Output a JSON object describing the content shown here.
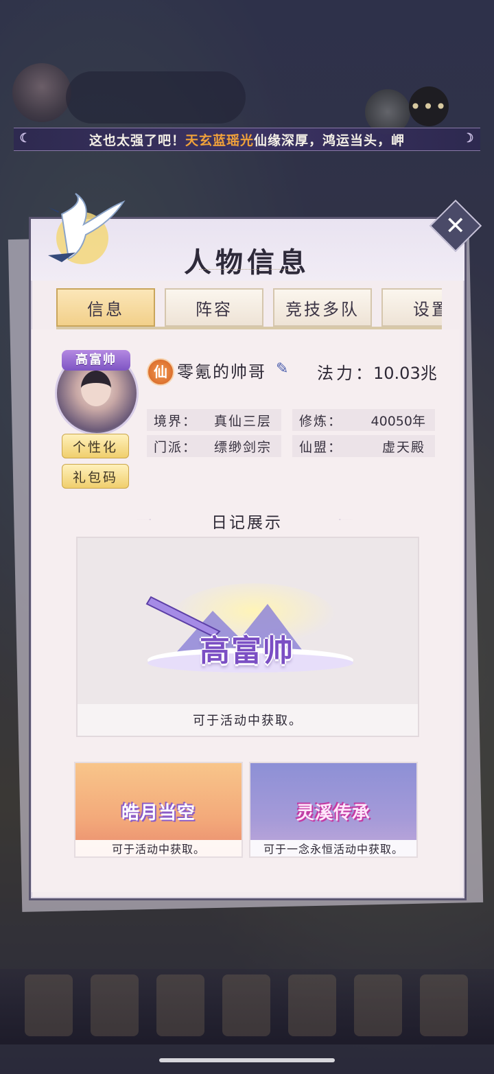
{
  "marquee": {
    "prefix": "这也太强了吧！",
    "highlight": "天玄蓝瑶光",
    "suffix": "仙缘深厚，鸿运当头，岬"
  },
  "chat_button": {
    "icon": "chat-bubble-icon",
    "glyph": "•••"
  },
  "panel": {
    "title": "人物信息",
    "close_glyph": "✕"
  },
  "tabs": [
    {
      "label": "信息",
      "active": true
    },
    {
      "label": "阵容",
      "active": false
    },
    {
      "label": "竞技多队",
      "active": false
    },
    {
      "label": "设置",
      "active": false
    }
  ],
  "profile": {
    "avatar_badge": "高富帅",
    "personalize_label": "个性化",
    "gift_code_label": "礼包码",
    "realm_icon_glyph": "仙",
    "name": "零氪的帅哥",
    "edit_glyph": "✎",
    "power_label": "法力：",
    "power_value": "10.03兆",
    "stats": [
      {
        "key": "境界：",
        "value": "真仙三层"
      },
      {
        "key": "修炼：",
        "value": "40050年"
      },
      {
        "key": "门派：",
        "value": "缥缈剑宗"
      },
      {
        "key": "仙盟：",
        "value": "虚天殿"
      }
    ]
  },
  "diary": {
    "section_title": "日记展示",
    "main_title_art": "高富帅",
    "main_caption": "可于活动中获取。",
    "cards": [
      {
        "art": "皓月当空",
        "caption": "可于活动中获取。",
        "accent": "#b07de0"
      },
      {
        "art": "灵溪传承",
        "caption": "可于一念永恒活动中获取。",
        "accent": "#d04fb2"
      }
    ]
  },
  "colors": {
    "highlight_orange": "#f0a13a",
    "tab_active": "#f2d08a",
    "title_purple": "#7b4fc4"
  }
}
